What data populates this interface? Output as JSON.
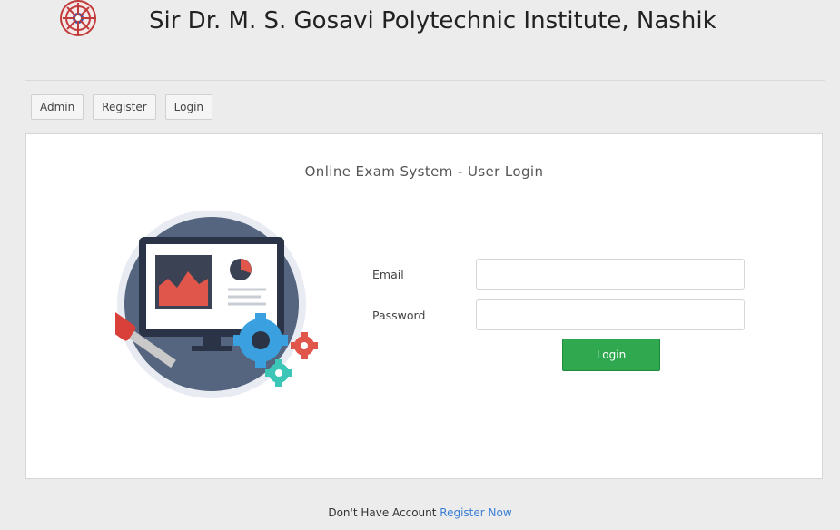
{
  "header": {
    "title": "Sir Dr. M. S. Gosavi Polytechnic Institute, Nashik",
    "logo_icon": "institute-logo-icon"
  },
  "nav": {
    "items": [
      {
        "label": "Admin"
      },
      {
        "label": "Register"
      },
      {
        "label": "Login"
      }
    ]
  },
  "login_card": {
    "title": "Online Exam System - User Login",
    "illustration_icon": "computer-gears-illustration-icon",
    "email_label": "Email",
    "email_value": "",
    "password_label": "Password",
    "password_value": "",
    "login_button": "Login"
  },
  "footer": {
    "text": "Don't Have Account",
    "link": "Register Now"
  },
  "colors": {
    "background": "#ececec",
    "login_button": "#2fa84f",
    "link": "#3a7fd5"
  }
}
